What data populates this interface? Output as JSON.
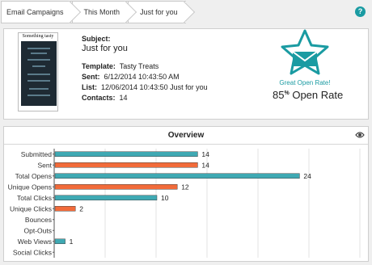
{
  "breadcrumb": [
    "Email Campaigns",
    "This Month",
    "Just for you"
  ],
  "help_icon": "question-circle-icon",
  "summary": {
    "thumbnail": {
      "title": "Something tasty"
    },
    "subject_label": "Subject:",
    "subject": "Just for you",
    "template_label": "Template:",
    "template": "Tasty Treats",
    "sent_label": "Sent:",
    "sent": "6/12/2014 10:43:50 AM",
    "list_label": "List:",
    "list": "12/06/2014 10:43:50 Just for you",
    "contacts_label": "Contacts:",
    "contacts": "14",
    "badge_icon": "star-envelope-icon",
    "badge_text": "Great Open Rate!",
    "open_rate_value": "85",
    "open_rate_unit": "%",
    "open_rate_label": "Open Rate"
  },
  "overview": {
    "title": "Overview",
    "eye_icon": "eye-icon"
  },
  "colors": {
    "teal": "#3fa9b3",
    "orange": "#f26b3a",
    "accent": "#1a9ba2"
  },
  "chart_data": {
    "type": "bar",
    "orientation": "horizontal",
    "categories": [
      "Submitted",
      "Sent",
      "Total Opens",
      "Unique Opens",
      "Total Clicks",
      "Unique Clicks",
      "Bounces",
      "Opt-Outs",
      "Web Views",
      "Social Clicks"
    ],
    "values": [
      14,
      14,
      24,
      12,
      10,
      2,
      0,
      0,
      1,
      0
    ],
    "bar_colors": [
      "teal",
      "orange",
      "teal",
      "orange",
      "teal",
      "orange",
      "teal",
      "orange",
      "teal",
      "orange"
    ],
    "data_labels": [
      "14",
      "14",
      "24",
      "12",
      "10",
      "2",
      "",
      "",
      "1",
      ""
    ],
    "xlim": [
      0,
      30
    ],
    "grid": true
  }
}
